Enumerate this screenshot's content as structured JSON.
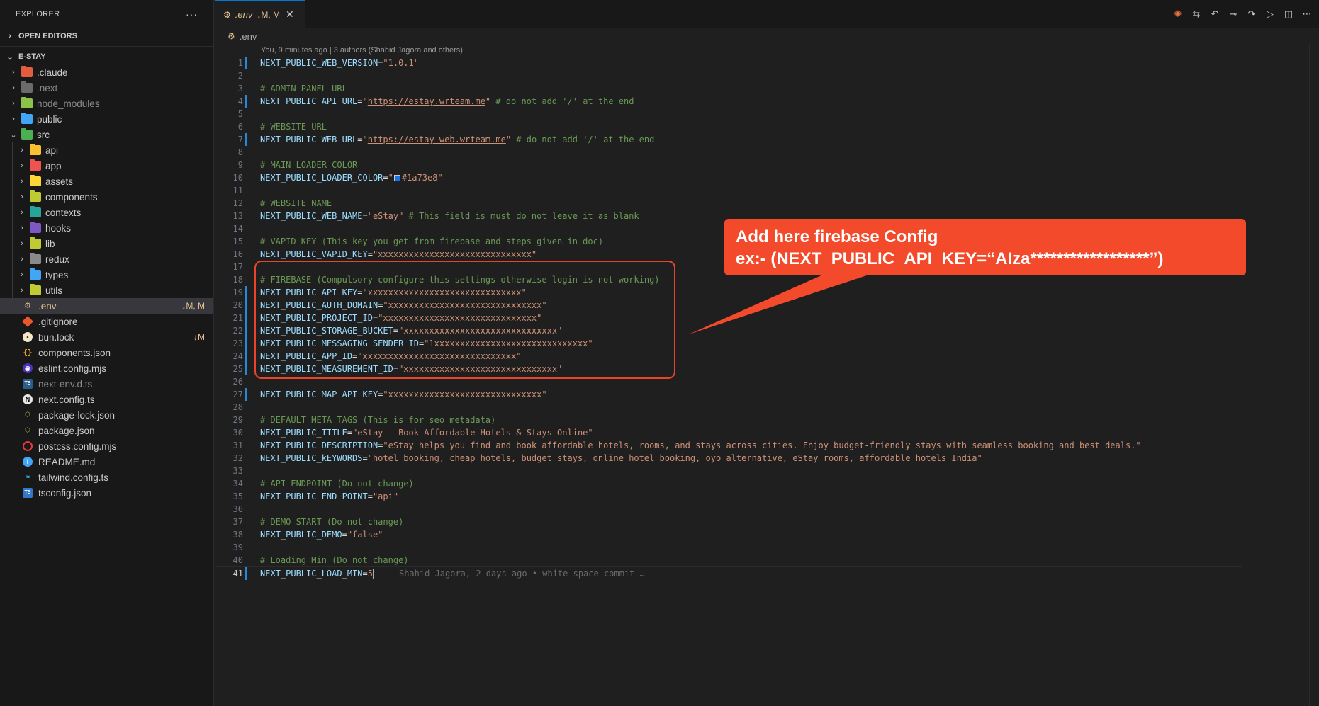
{
  "sidebar": {
    "title": "EXPLORER",
    "menu_icon": "ellipsis-icon",
    "open_editors": "OPEN EDITORS",
    "project": "E-STAY",
    "items": [
      {
        "label": ".claude",
        "type": "folder",
        "icon_color": "#e25d3f"
      },
      {
        "label": ".next",
        "type": "folder",
        "icon_color": "#6b6b6b"
      },
      {
        "label": "node_modules",
        "type": "folder",
        "icon_color": "#8bc34a"
      },
      {
        "label": "public",
        "type": "folder",
        "icon_color": "#42a5f5"
      },
      {
        "label": "src",
        "type": "folder-open",
        "icon_color": "#4caf50"
      },
      {
        "label": "api",
        "type": "folder",
        "icon_color": "#fbc02d"
      },
      {
        "label": "app",
        "type": "folder",
        "icon_color": "#ef5350"
      },
      {
        "label": "assets",
        "type": "folder",
        "icon_color": "#fdd835"
      },
      {
        "label": "components",
        "type": "folder",
        "icon_color": "#c0ca33"
      },
      {
        "label": "contexts",
        "type": "folder",
        "icon_color": "#26a69a"
      },
      {
        "label": "hooks",
        "type": "folder",
        "icon_color": "#7e57c2"
      },
      {
        "label": "lib",
        "type": "folder",
        "icon_color": "#c0ca33"
      },
      {
        "label": "redux",
        "type": "folder",
        "icon_color": "#8a8a8a"
      },
      {
        "label": "types",
        "type": "folder",
        "icon_color": "#42a5f5"
      },
      {
        "label": "utils",
        "type": "folder",
        "icon_color": "#c0ca33"
      },
      {
        "label": ".env",
        "type": "file",
        "badge": "↓M, M"
      },
      {
        "label": ".gitignore",
        "type": "file"
      },
      {
        "label": "bun.lock",
        "type": "file",
        "badge": "↓M"
      },
      {
        "label": "components.json",
        "type": "file"
      },
      {
        "label": "eslint.config.mjs",
        "type": "file"
      },
      {
        "label": "next-env.d.ts",
        "type": "file"
      },
      {
        "label": "next.config.ts",
        "type": "file"
      },
      {
        "label": "package-lock.json",
        "type": "file"
      },
      {
        "label": "package.json",
        "type": "file"
      },
      {
        "label": "postcss.config.mjs",
        "type": "file"
      },
      {
        "label": "README.md",
        "type": "file"
      },
      {
        "label": "tailwind.config.ts",
        "type": "file"
      },
      {
        "label": "tsconfig.json",
        "type": "file"
      }
    ]
  },
  "tab": {
    "name": ".env",
    "status": "↓M, M",
    "close": "✕"
  },
  "breadcrumb": ".env",
  "editor": {
    "blame_top": "You, 9 minutes ago | 3 authors (Shahid Jagora and others)",
    "inline_blame": "Shahid Jagora, 2 days ago • white space commit …",
    "lines": {
      "l1_k": "NEXT_PUBLIC_WEB_VERSION",
      "l1_v": "\"1.0.1\"",
      "l3": "# ADMIN_PANEL URL",
      "l4_k": "NEXT_PUBLIC_API_URL",
      "l4_q": "\"",
      "l4_u": "https://estay.wrteam.me",
      "l4_c": " # do not add '/' at the end",
      "l6": "# WEBSITE URL",
      "l7_k": "NEXT_PUBLIC_WEB_URL",
      "l7_u": "https://estay-web.wrteam.me",
      "l7_c": " # do not add '/' at the end",
      "l9": "# MAIN LOADER COLOR",
      "l10_k": "NEXT_PUBLIC_LOADER_COLOR",
      "l10_v": "#1a73e8",
      "l12": "# WEBSITE NAME",
      "l13_k": "NEXT_PUBLIC_WEB_NAME",
      "l13_v": "\"eStay\"",
      "l13_c": " # This field is must do not leave it as blank",
      "l15": "# VAPID KEY (This key you get from firebase and steps given in doc)",
      "l16_k": "NEXT_PUBLIC_VAPID_KEY",
      "l16_v": "\"xxxxxxxxxxxxxxxxxxxxxxxxxxxxxx\"",
      "l18": "# FIREBASE (Compulsory configure this settings otherwise login is not working)",
      "l19_k": "NEXT_PUBLIC_API_KEY",
      "l19_v": "\"xxxxxxxxxxxxxxxxxxxxxxxxxxxxxx\"",
      "l20_k": "NEXT_PUBLIC_AUTH_DOMAIN",
      "l20_v": "\"xxxxxxxxxxxxxxxxxxxxxxxxxxxxxx\"",
      "l21_k": "NEXT_PUBLIC_PROJECT_ID",
      "l21_v": "\"xxxxxxxxxxxxxxxxxxxxxxxxxxxxxx\"",
      "l22_k": "NEXT_PUBLIC_STORAGE_BUCKET",
      "l22_v": "\"xxxxxxxxxxxxxxxxxxxxxxxxxxxxxx\"",
      "l23_k": "NEXT_PUBLIC_MESSAGING_SENDER_ID",
      "l23_v": "\"1xxxxxxxxxxxxxxxxxxxxxxxxxxxxxx\"",
      "l24_k": "NEXT_PUBLIC_APP_ID",
      "l24_v": "\"xxxxxxxxxxxxxxxxxxxxxxxxxxxxxx\"",
      "l25_k": "NEXT_PUBLIC_MEASUREMENT_ID",
      "l25_v": "\"xxxxxxxxxxxxxxxxxxxxxxxxxxxxxx\"",
      "l27_k": "NEXT_PUBLIC_MAP_API_KEY",
      "l27_v": "\"xxxxxxxxxxxxxxxxxxxxxxxxxxxxxx\"",
      "l29": "# DEFAULT META TAGS (This is for seo metadata)",
      "l30_k": "NEXT_PUBLIC_TITLE",
      "l30_v": "\"eStay - Book Affordable Hotels & Stays Online\"",
      "l31_k": "NEXT_PUBLIC_DESCRIPTION",
      "l31_v": "\"eStay helps you find and book affordable hotels, rooms, and stays across cities. Enjoy budget-friendly stays with seamless booking and best deals.\"",
      "l32_k": "NEXT_PUBLIC_kEYWORDS",
      "l32_v": "\"hotel booking, cheap hotels, budget stays, online hotel booking, oyo alternative, eStay rooms, affordable hotels India\"",
      "l34": "# API ENDPOINT (Do not change)",
      "l35_k": "NEXT_PUBLIC_END_POINT",
      "l35_v": "\"api\"",
      "l37": "# DEMO START (Do not change)",
      "l38_k": "NEXT_PUBLIC_DEMO",
      "l38_v": "\"false\"",
      "l40": "# Loading Min (Do not change)",
      "l41_k": "NEXT_PUBLIC_LOAD_MIN",
      "l41_v": "5"
    }
  },
  "callout": {
    "line1": "Add here firebase Config",
    "line2": "ex:- (NEXT_PUBLIC_API_KEY=“AIza******************”)",
    "color": "#f24a2a"
  },
  "toolbar_icons": [
    "spark-icon",
    "git-compare-icon",
    "go-back-icon",
    "commit-icon",
    "go-forward-icon",
    "run-icon",
    "split-editor-icon",
    "more-actions-icon"
  ]
}
